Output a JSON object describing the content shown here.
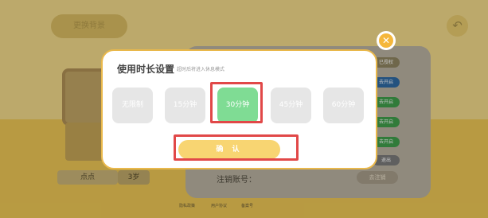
{
  "background": {
    "top_button": "更换背景",
    "back_icon": "back-arrow-icon",
    "child_name": "点点",
    "child_age": "3岁",
    "account_label": "注销账号：",
    "logout_button": "去注销",
    "side_pills": [
      "已授权",
      "去开启",
      "去开启",
      "去开启",
      "去开启",
      "退出"
    ],
    "footer_links": [
      "隐私政策",
      "用户协议",
      "备案号"
    ]
  },
  "modal": {
    "title": "使用时长设置",
    "subtitle": "超时后将进入休息模式",
    "options": [
      "无限制",
      "15分钟",
      "30分钟",
      "45分钟",
      "60分钟"
    ],
    "selected_index": 2,
    "confirm_label": "确 认",
    "close_icon": "close-icon"
  },
  "colors": {
    "selected_option": "#7fdc94",
    "confirm_button": "#f8d572",
    "highlight_frame": "#e14848",
    "close_button": "#f5b73c"
  }
}
